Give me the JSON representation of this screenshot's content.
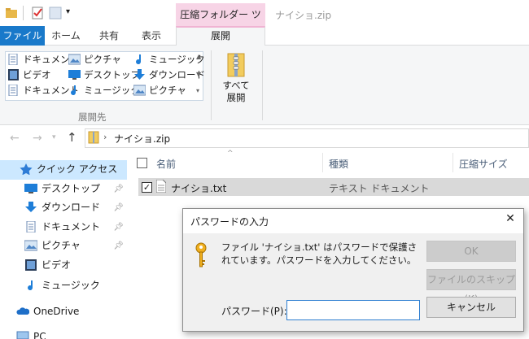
{
  "window": {
    "title": "ナイショ.zip",
    "context_tab_group": "圧縮フォルダー ツール"
  },
  "ribbon": {
    "tabs": [
      "ファイル",
      "ホーム",
      "共有",
      "表示",
      "展開"
    ],
    "destinations": [
      {
        "label": "ドキュメント",
        "icon": "documents-icon"
      },
      {
        "label": "ピクチャ",
        "icon": "pictures-icon"
      },
      {
        "label": "ミュージック",
        "icon": "music-icon"
      },
      {
        "label": "ビデオ",
        "icon": "videos-icon"
      },
      {
        "label": "デスクトップ",
        "icon": "desktop-icon"
      },
      {
        "label": "ダウンロード",
        "icon": "downloads-icon"
      },
      {
        "label": "ドキュメント",
        "icon": "documents-icon"
      },
      {
        "label": "ミュージック",
        "icon": "music-icon"
      },
      {
        "label": "ピクチャ",
        "icon": "pictures-icon"
      }
    ],
    "group_caption": "展開先",
    "extract_all_line1": "すべて",
    "extract_all_line2": "展開"
  },
  "addressbar": {
    "path": "ナイショ.zip",
    "separator": "›"
  },
  "nav": {
    "quick_access": "クイック アクセス",
    "items": [
      {
        "label": "デスクトップ",
        "pinned": true
      },
      {
        "label": "ダウンロード",
        "pinned": true
      },
      {
        "label": "ドキュメント",
        "pinned": true
      },
      {
        "label": "ピクチャ",
        "pinned": true
      },
      {
        "label": "ビデオ",
        "pinned": false
      },
      {
        "label": "ミュージック",
        "pinned": false
      }
    ],
    "onedrive": "OneDrive",
    "pc": "PC"
  },
  "filelist": {
    "columns": [
      "名前",
      "種類",
      "圧縮サイズ"
    ],
    "rows": [
      {
        "name": "ナイショ.txt",
        "type": "テキスト ドキュメント",
        "checked": true
      }
    ]
  },
  "dialog": {
    "title": "パスワードの入力",
    "close_glyph": "✕",
    "message": "ファイル 'ナイショ.txt' はパスワードで保護されています。パスワードを入力してください。",
    "ok_label": "OK",
    "skip_label": "ファイルのスキップ(K)",
    "cancel_label": "キャンセル",
    "password_label": "パスワード(P):",
    "password_value": ""
  },
  "colors": {
    "file_tab": "#1979ca",
    "context_tab": "#f7d4e6",
    "selection": "#cce8ff",
    "row_highlight": "#d9d9d9"
  }
}
